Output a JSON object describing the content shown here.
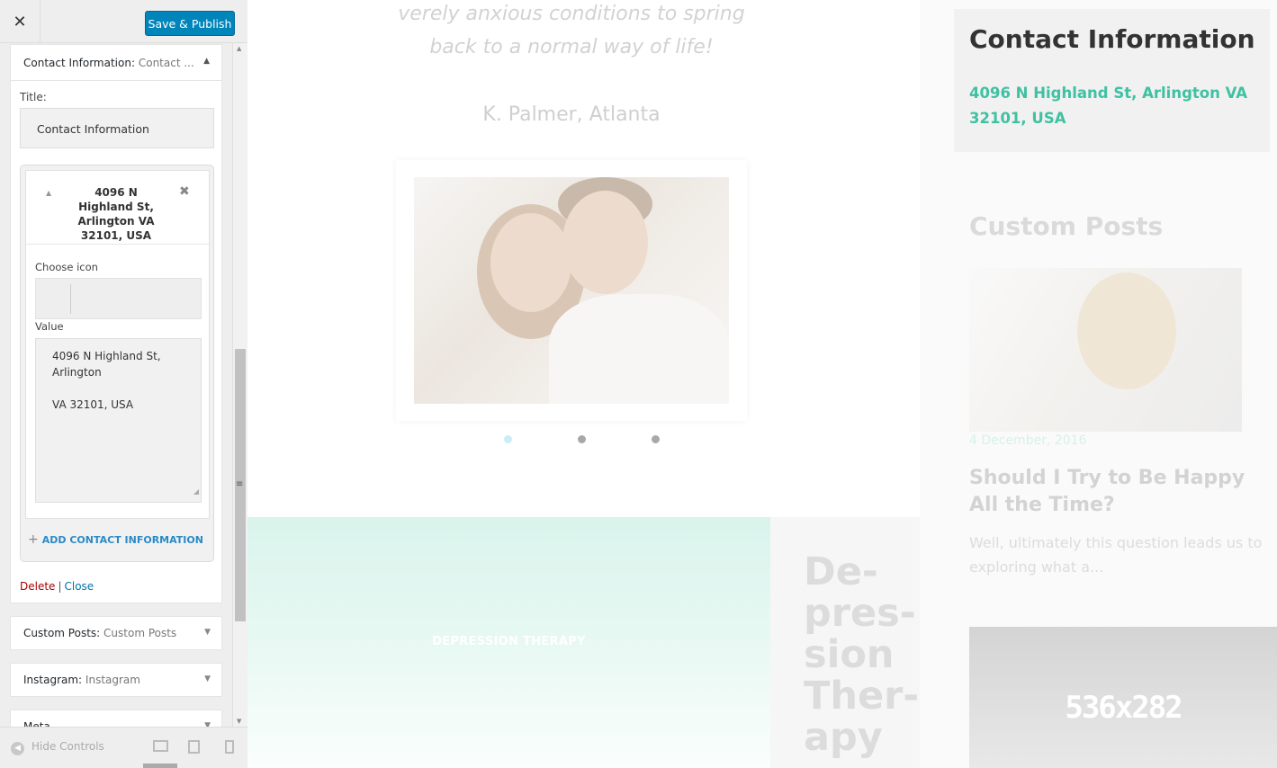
{
  "toolbar": {
    "close_label": "✕",
    "publish_label": "Save & Publish"
  },
  "widget_contact": {
    "header_name": "Contact Information:",
    "header_sub": "Contact ...",
    "title_label": "Title:",
    "title_value": "Contact Information",
    "item": {
      "title": "4096 N Highland St, Arlington VA 32101, USA",
      "choose_icon_label": "Choose icon",
      "value_label": "Value",
      "value": "4096 N Highland St, Arlington\n\nVA 32101, USA"
    },
    "add_label": "ADD CONTACT INFORMATION",
    "delete_label": "Delete",
    "separator": "|",
    "close_label": "Close"
  },
  "widgets": [
    {
      "name": "Custom Posts:",
      "sub": "Custom Posts"
    },
    {
      "name": "Instagram:",
      "sub": "Instagram"
    },
    {
      "name": "Meta",
      "sub": ""
    }
  ],
  "footer": {
    "hide_label": "Hide Controls"
  },
  "preview": {
    "quote_line1": "verely anxious conditions to spring",
    "quote_line2": "back to a normal way of life!",
    "author": "K. Palmer, Atlanta",
    "therapy_label": "DEPRESSION THERAPY",
    "therapy_word": "De-pres-sion Ther-apy",
    "contact_title": "Contact Information",
    "contact_address": "4096 N Highland St, Arlington VA 32101, USA",
    "custom_posts_title": "Custom Posts",
    "post_date": "4 December, 2016",
    "post_title": "Should I Try to Be Happy All the Time?",
    "post_excerpt": "Well, ultimately this question leads us to exploring what a...",
    "placeholder_label": "536x282"
  },
  "colors": {
    "accent": "#0085ba",
    "contact_address": "#3fc1a2",
    "link": "#2b8ac6",
    "delete": "#aa0000"
  }
}
